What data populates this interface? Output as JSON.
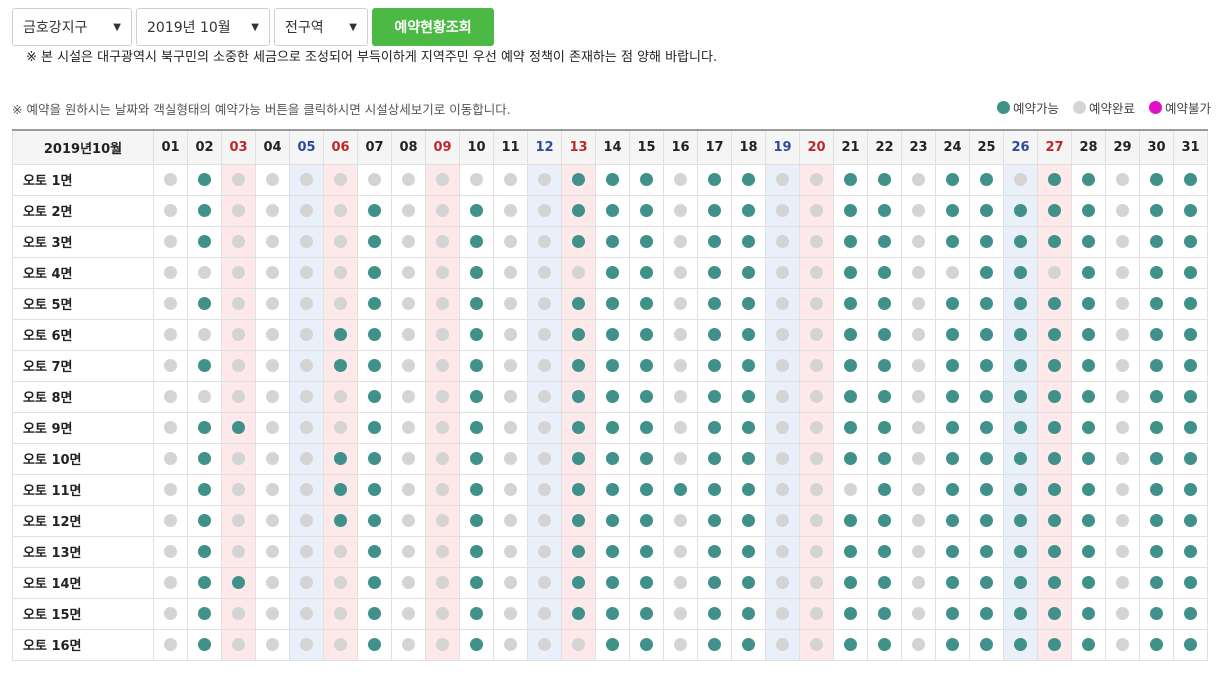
{
  "filters": {
    "district": "금호강지구",
    "month": "2019년 10월",
    "area": "전구역",
    "search_label": "예약현황조회"
  },
  "notice": "※ 본 시설은 대구광역시 북구민의 소중한 세금으로 조성되어 부득이하게 지역주민 우선 예약 정책이 존재하는 점 양해 바랍니다.",
  "help_text": "※ 예약을 원하시는 날짜와 객실형태의 예약가능 버튼을 클릭하시면 시설상세보기로 이동합니다.",
  "legend": [
    {
      "label": "예약가능",
      "color": "#3f918a"
    },
    {
      "label": "예약완료",
      "color": "#d4d4d4"
    },
    {
      "label": "예약불가",
      "color": "#e010c8"
    }
  ],
  "colors": {
    "available": "#3f918a",
    "booked": "#d4d4d4",
    "unavailable": "#e010c8",
    "sunday": "#c0272d",
    "saturday": "#2d4aa0",
    "search_button": "#4cb944"
  },
  "table": {
    "corner": "2019년10월",
    "days": [
      {
        "label": "01",
        "type": "weekday"
      },
      {
        "label": "02",
        "type": "weekday"
      },
      {
        "label": "03",
        "type": "holiday"
      },
      {
        "label": "04",
        "type": "weekday"
      },
      {
        "label": "05",
        "type": "saturday"
      },
      {
        "label": "06",
        "type": "holiday"
      },
      {
        "label": "07",
        "type": "weekday"
      },
      {
        "label": "08",
        "type": "weekday"
      },
      {
        "label": "09",
        "type": "holiday"
      },
      {
        "label": "10",
        "type": "weekday"
      },
      {
        "label": "11",
        "type": "weekday"
      },
      {
        "label": "12",
        "type": "saturday"
      },
      {
        "label": "13",
        "type": "holiday"
      },
      {
        "label": "14",
        "type": "weekday"
      },
      {
        "label": "15",
        "type": "weekday"
      },
      {
        "label": "16",
        "type": "weekday"
      },
      {
        "label": "17",
        "type": "weekday"
      },
      {
        "label": "18",
        "type": "weekday"
      },
      {
        "label": "19",
        "type": "saturday"
      },
      {
        "label": "20",
        "type": "holiday"
      },
      {
        "label": "21",
        "type": "weekday"
      },
      {
        "label": "22",
        "type": "weekday"
      },
      {
        "label": "23",
        "type": "weekday"
      },
      {
        "label": "24",
        "type": "weekday"
      },
      {
        "label": "25",
        "type": "weekday"
      },
      {
        "label": "26",
        "type": "saturday"
      },
      {
        "label": "27",
        "type": "holiday"
      },
      {
        "label": "28",
        "type": "weekday"
      },
      {
        "label": "29",
        "type": "weekday"
      },
      {
        "label": "30",
        "type": "weekday"
      },
      {
        "label": "31",
        "type": "weekday"
      }
    ],
    "rows": [
      {
        "name": "오토 1면",
        "status": "0100000000001110110011011011011"
      },
      {
        "name": "오토 2면",
        "status": "0100001001001110110011011111011"
      },
      {
        "name": "오토 3면",
        "status": "0100001001001110110011011111011"
      },
      {
        "name": "오토 4면",
        "status": "0000001001000110110011001101011"
      },
      {
        "name": "오토 5면",
        "status": "0100001001001110110011011111011"
      },
      {
        "name": "오토 6면",
        "status": "0000011001001110110011011111011"
      },
      {
        "name": "오토 7면",
        "status": "0100011001001110110011011111011"
      },
      {
        "name": "오토 8면",
        "status": "0000001001001110110011011111011"
      },
      {
        "name": "오토 9면",
        "status": "0110001001001110110011011111011"
      },
      {
        "name": "오토 10면",
        "status": "0100011001001110110011011111011"
      },
      {
        "name": "오토 11면",
        "status": "0100011001001111110001011111011"
      },
      {
        "name": "오토 12면",
        "status": "0100011001001110110011011111011"
      },
      {
        "name": "오토 13면",
        "status": "0100001001001110110011011111011"
      },
      {
        "name": "오토 14면",
        "status": "0110001001001110110011011111011"
      },
      {
        "name": "오토 15면",
        "status": "0100001001001110110011011111011"
      },
      {
        "name": "오토 16면",
        "status": "0100001001000110110011011111011"
      }
    ]
  }
}
